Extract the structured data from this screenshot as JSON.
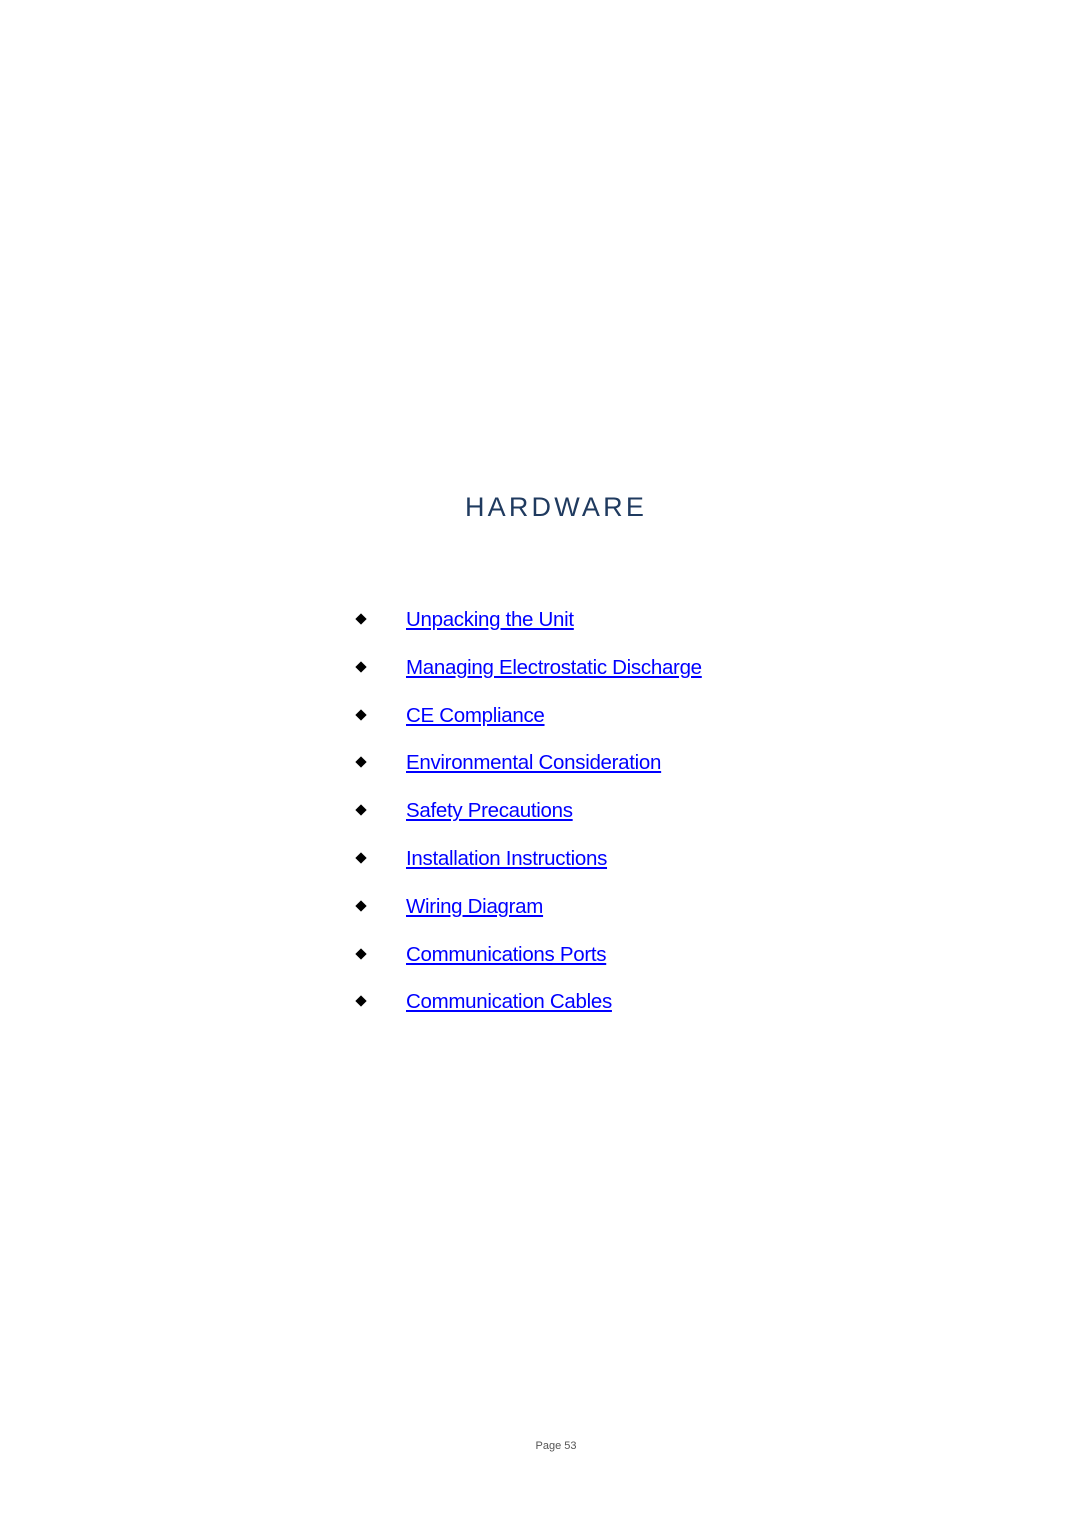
{
  "page": {
    "title": "HARDWARE",
    "page_label": "Page 53"
  },
  "toc": {
    "bullet_icon": "diamond-bullet",
    "link_color": "#0000ff",
    "items": [
      {
        "label": "Unpacking the Unit"
      },
      {
        "label": "Managing Electrostatic Discharge"
      },
      {
        "label": "CE Compliance"
      },
      {
        "label": "Environmental Consideration"
      },
      {
        "label": "Safety Precautions"
      },
      {
        "label": "Installation Instructions"
      },
      {
        "label": "Wiring Diagram"
      },
      {
        "label": "Communications Ports"
      },
      {
        "label": "Communication Cables"
      }
    ]
  },
  "colors": {
    "title": "#1f3a5f",
    "link": "#0000ff",
    "bullet": "#000000",
    "page_number": "#555555"
  }
}
